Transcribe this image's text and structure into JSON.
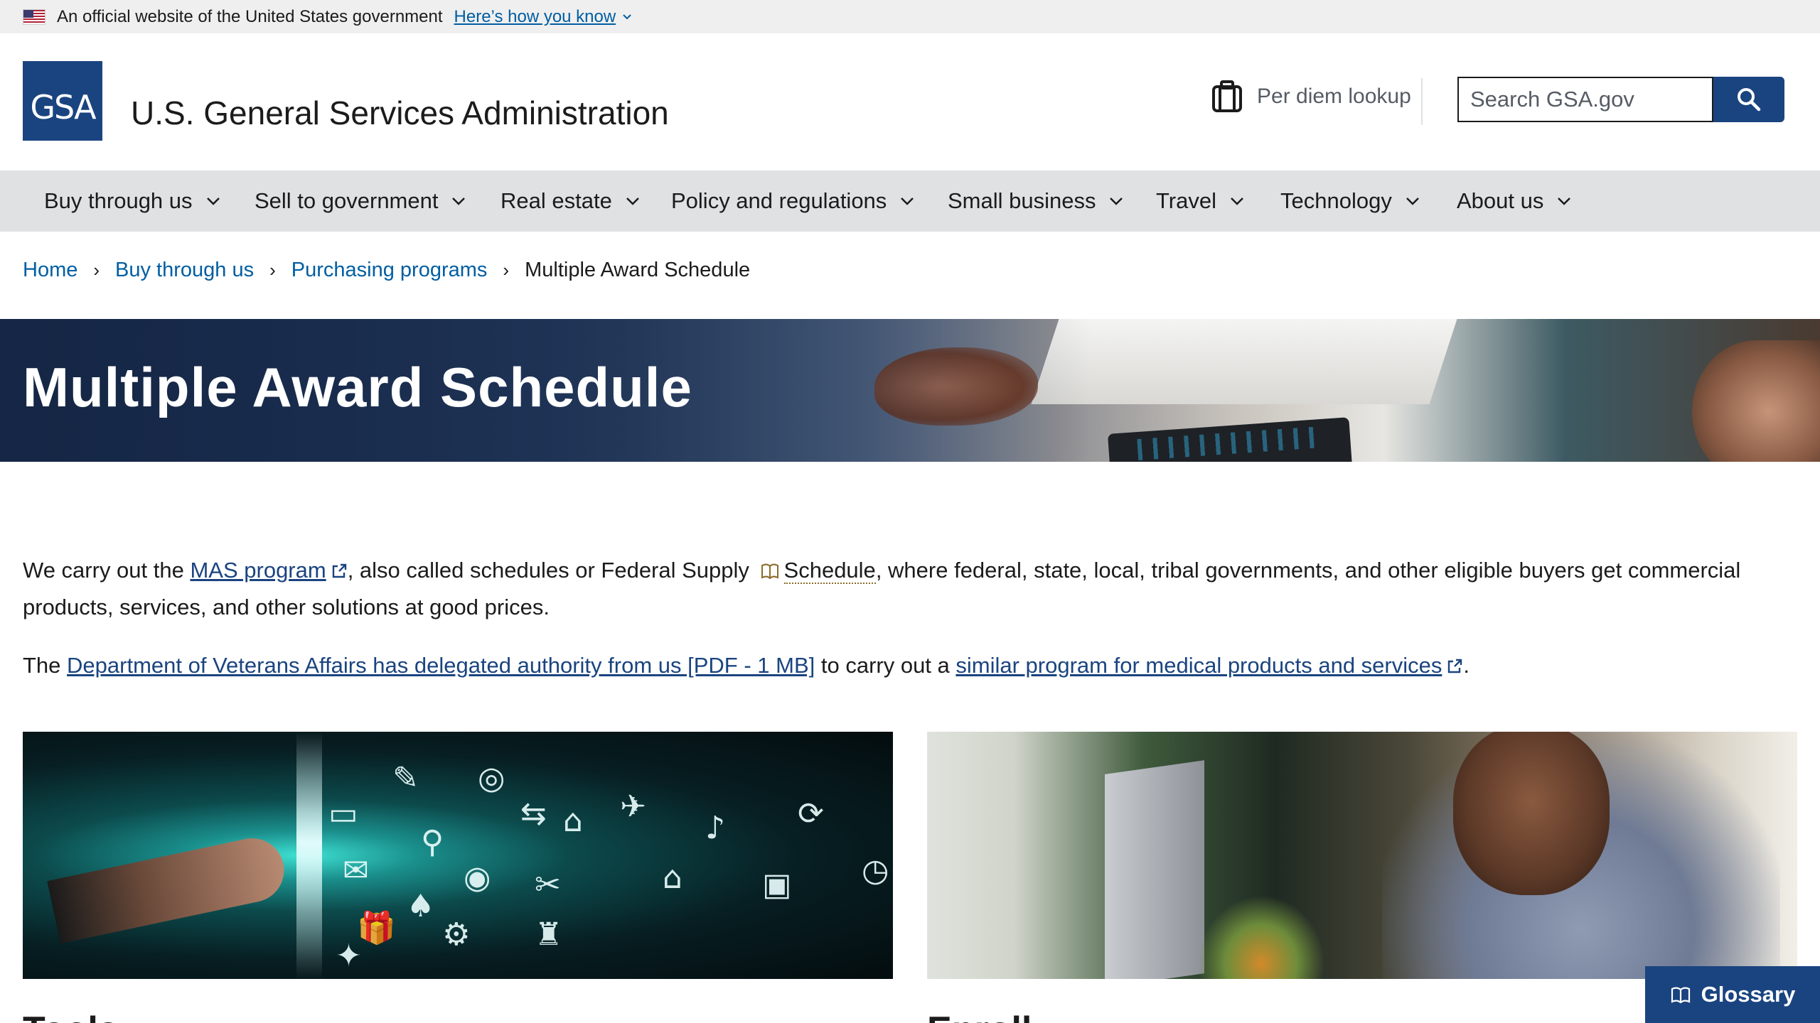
{
  "banner": {
    "official_text": "An official website of the United States government",
    "know_link": "Here’s how you know"
  },
  "header": {
    "logo_text": "GSA",
    "agency_name": "U.S. General Services Administration",
    "per_diem_label": "Per diem lookup",
    "search_placeholder": "Search GSA.gov"
  },
  "nav": {
    "items": [
      {
        "label": "Buy through us"
      },
      {
        "label": "Sell to government"
      },
      {
        "label": "Real estate"
      },
      {
        "label": "Policy and regulations"
      },
      {
        "label": "Small business"
      },
      {
        "label": "Travel"
      },
      {
        "label": "Technology"
      },
      {
        "label": "About us"
      }
    ]
  },
  "breadcrumb": {
    "items": [
      "Home",
      "Buy through us",
      "Purchasing programs"
    ],
    "current": "Multiple Award Schedule",
    "separator": "›"
  },
  "hero": {
    "title": "Multiple Award Schedule"
  },
  "content": {
    "p1": {
      "before": "We carry out the ",
      "link": "MAS program",
      "mid": ", also called schedules or Federal Supply ",
      "term": "Schedule",
      "after": ", where federal, state, local, tribal governments, and other eligible buyers get commercial products, services, and other solutions at good prices."
    },
    "p2": {
      "before": "The ",
      "link1": "Department of Veterans Affairs has delegated authority from us [PDF - 1 MB]",
      "mid": " to carry out a ",
      "link2": "similar program for medical products and services",
      "after": "."
    }
  },
  "cards": {
    "left_heading": "Tools",
    "right_heading": "Enroll"
  },
  "glossary_button": "Glossary",
  "colors": {
    "primary": "#1a4480",
    "link": "#005ea2",
    "nav_bg": "#dfe1e2",
    "banner_bg": "#efefef"
  },
  "icons": {
    "flag": "us-flag-icon",
    "suitcase": "suitcase-icon",
    "search": "search-icon",
    "chevron": "chevron-down-icon",
    "external": "external-link-icon",
    "book": "book-icon"
  }
}
